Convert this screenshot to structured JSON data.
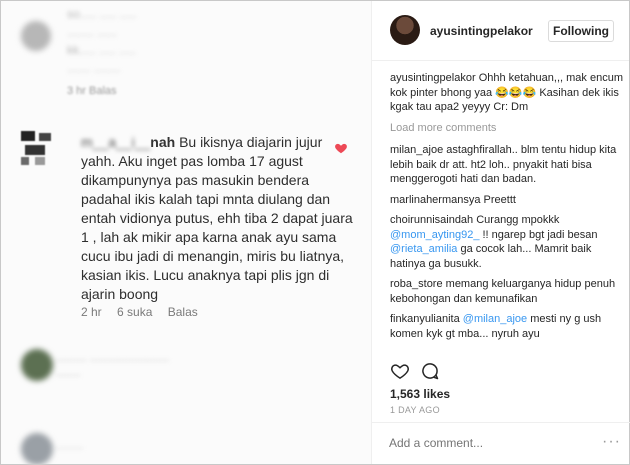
{
  "left_photo": {
    "blur_top_lines": [
      "so..... ..... .....",
      "........ ......",
      "kk..... ..... .....",
      "....... ........",
      "........ ...."
    ],
    "blur_top_meta": "3 hr    Balas",
    "main_comment": {
      "username_hidden": "m__a__i__",
      "username_suffix": "nah",
      "text": "Bu ikisnya diajarin jujur yahh. Aku inget pas lomba 17 agust dikampunynya pas masukin bendera padahal ikis kalah tapi mnta diulang dan entah vidionya putus, ehh tiba 2 dapat juara 1 , lah ak mikir apa karna anak ayu sama cucu ibu jadi di menangin, miris bu liatnya, kasian ikis. Lucu anaknya tapi plis jgn di ajarin boong",
      "time": "2 hr",
      "likes": "6 suka",
      "reply": "Balas"
    },
    "blur_bottom_lines": [
      "..........   ..........................",
      "........"
    ],
    "blur_bottom2": "........."
  },
  "panel": {
    "username": "ayusintingpelakor",
    "follow_label": "Following",
    "caption_user": "ayusintingpelakor",
    "caption_text": "Ohhh ketahuan,,, mak encum kok pinter bhong yaa 😂😂😂 Kasihan dek ikis kgak tau apa2 yeyyy Cr: Dm",
    "load_more": "Load more comments",
    "comments": [
      {
        "user": "milan_ajoe",
        "text": "astaghfirallah.. blm tentu hidup kita lebih baik dr att. ht2 loh.. pnyakit hati bisa menggerogoti hati dan badan."
      },
      {
        "user": "marlinahermansya",
        "text": "Preettt"
      },
      {
        "user": "choirunnisaindah",
        "text": "Curangg mpokkk",
        "mention": "@mom_ayting92_",
        "text2": "!! ngarep bgt jadi besan",
        "mention2": "@rieta_amilia",
        "text3": "ga cocok lah... Mamrit baik hatinya ga busukk."
      },
      {
        "user": "roba_store",
        "text": "memang keluarganya hidup penuh kebohongan dan kemunafikan"
      },
      {
        "user": "finkanyulianita",
        "mention": "@milan_ajoe",
        "text": "mesti ny g ush komen kyk gt mba... nyruh ayu"
      }
    ],
    "likes": "1,563 likes",
    "time_ago": "1 DAY AGO",
    "add_comment_placeholder": "Add a comment...",
    "more_icon": "···",
    "icons": [
      "heart-outline-icon",
      "comment-bubble-icon"
    ]
  }
}
